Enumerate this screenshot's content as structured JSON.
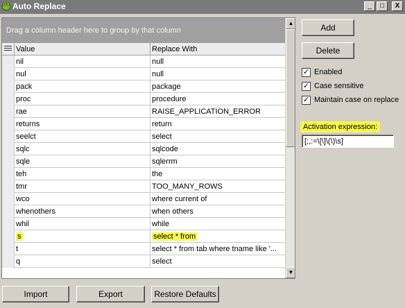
{
  "window": {
    "title": "Auto Replace",
    "min_glyph": "_",
    "max_glyph": "□",
    "close_glyph": "X",
    "icon": "frog-app-icon"
  },
  "grid": {
    "group_prompt": "Drag a column header here to group by that column",
    "columns": {
      "value": "Value",
      "replace_with": "Replace With"
    },
    "rows": [
      {
        "value": "nil",
        "replace": "null"
      },
      {
        "value": "nul",
        "replace": "null"
      },
      {
        "value": "pack",
        "replace": "package"
      },
      {
        "value": "proc",
        "replace": "procedure"
      },
      {
        "value": "rae",
        "replace": "RAISE_APPLICATION_ERROR"
      },
      {
        "value": "returns",
        "replace": "return"
      },
      {
        "value": "seelct",
        "replace": "select"
      },
      {
        "value": "sqlc",
        "replace": "sqlcode"
      },
      {
        "value": "sqle",
        "replace": "sqlerrm"
      },
      {
        "value": "teh",
        "replace": "the"
      },
      {
        "value": "tmr",
        "replace": "TOO_MANY_ROWS"
      },
      {
        "value": "wco",
        "replace": "where current of"
      },
      {
        "value": "whenothers",
        "replace": "when others"
      },
      {
        "value": "whil",
        "replace": "while"
      },
      {
        "value": "s",
        "replace": "select * from",
        "highlighted": true
      },
      {
        "value": "t",
        "replace": "select * from tab where tname like '..."
      },
      {
        "value": "q",
        "replace": "select"
      }
    ],
    "scroll_up_glyph": "▲",
    "scroll_down_glyph": "▼"
  },
  "buttons": {
    "add": "Add",
    "delete": "Delete",
    "import": "Import",
    "export": "Export",
    "restore_defaults": "Restore Defaults"
  },
  "options": {
    "enabled": {
      "label": "Enabled",
      "checked": true
    },
    "case_sensitive": {
      "label": "Case sensitive",
      "checked": true
    },
    "maintain_case": {
      "label": "Maintain case on replace",
      "checked": true
    }
  },
  "activation": {
    "label": "Activation expression:",
    "value": "[;,:=\\[\\]\\(\\)\\s]"
  },
  "colors": {
    "highlight": "#f6f84a",
    "titlebar": "#7a7a7a",
    "group_panel": "#a0a0a0",
    "window_bg": "#d4d0c8"
  }
}
